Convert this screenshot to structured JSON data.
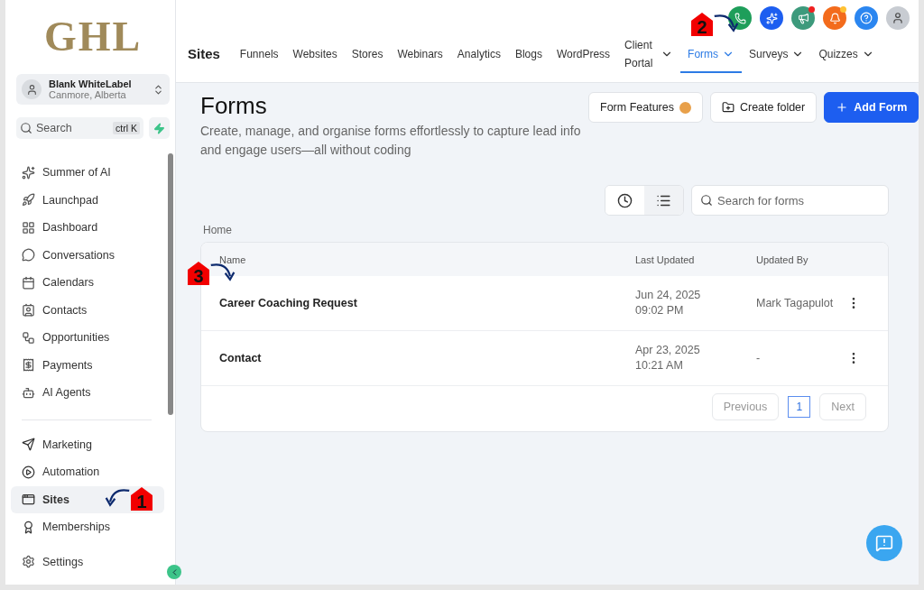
{
  "sidebar": {
    "logo": "GHL",
    "account": {
      "name": "Blank WhiteLabel",
      "location": "Canmore, Alberta"
    },
    "search": {
      "placeholder": "Search",
      "shortcut": "ctrl K"
    },
    "items": [
      {
        "label": "Summer of AI",
        "selected": false
      },
      {
        "label": "Launchpad",
        "selected": false
      },
      {
        "label": "Dashboard",
        "selected": false
      },
      {
        "label": "Conversations",
        "selected": false
      },
      {
        "label": "Calendars",
        "selected": false
      },
      {
        "label": "Contacts",
        "selected": false
      },
      {
        "label": "Opportunities",
        "selected": false
      },
      {
        "label": "Payments",
        "selected": false
      },
      {
        "label": "AI Agents",
        "selected": false
      }
    ],
    "items_2": [
      {
        "label": "Marketing",
        "selected": false
      },
      {
        "label": "Automation",
        "selected": false
      },
      {
        "label": "Sites",
        "selected": true
      },
      {
        "label": "Memberships",
        "selected": false
      }
    ],
    "settings": "Settings"
  },
  "header": {
    "title": "Sites",
    "tabs": [
      {
        "label": "Funnels",
        "dropdown": false,
        "selected": false
      },
      {
        "label": "Websites",
        "dropdown": false,
        "selected": false
      },
      {
        "label": "Stores",
        "dropdown": false,
        "selected": false
      },
      {
        "label": "Webinars",
        "dropdown": false,
        "selected": false
      },
      {
        "label": "Analytics",
        "dropdown": false,
        "selected": false
      },
      {
        "label": "Blogs",
        "dropdown": false,
        "selected": false
      },
      {
        "label": "WordPress",
        "dropdown": false,
        "selected": false
      },
      {
        "label": "Client Portal",
        "dropdown": true,
        "selected": false
      },
      {
        "label": "Forms",
        "dropdown": true,
        "selected": true
      },
      {
        "label": "Surveys",
        "dropdown": true,
        "selected": false
      },
      {
        "label": "Quizzes",
        "dropdown": true,
        "selected": false
      }
    ]
  },
  "page": {
    "title": "Forms",
    "description": "Create, manage, and organise forms effortlessly to capture lead info and engage users—all without coding",
    "buttons": [
      {
        "label": "Form Features",
        "kind": "features"
      },
      {
        "label": "Create folder",
        "kind": "folder"
      },
      {
        "label": "Add Form",
        "kind": "primary"
      }
    ],
    "views": [
      {
        "kind": "recent",
        "selected": false
      },
      {
        "kind": "list",
        "selected": true
      }
    ],
    "search": {
      "placeholder": "Search for forms"
    },
    "breadcrumb": "Home"
  },
  "table": {
    "columns": [
      "Name",
      "Last Updated",
      "Updated By"
    ],
    "rows": [
      {
        "name": "Career Coaching Request",
        "date": "Jun 24, 2025",
        "time": "09:02 PM",
        "by": "Mark Tagapulot"
      },
      {
        "name": "Contact",
        "date": "Apr 23, 2025",
        "time": "10:21 AM",
        "by": "-"
      }
    ],
    "pagination": {
      "previous": "Previous",
      "pages": [
        {
          "label": "1",
          "selected": true
        }
      ],
      "next": "Next"
    }
  },
  "annotations": [
    {
      "label": "1"
    },
    {
      "label": "2"
    },
    {
      "label": "3"
    }
  ]
}
